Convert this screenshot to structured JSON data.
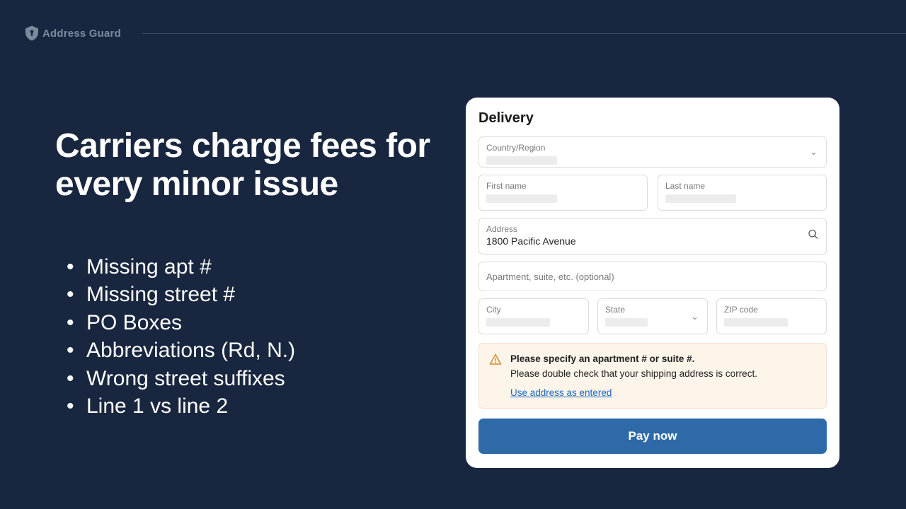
{
  "brand": {
    "name": "Address Guard"
  },
  "headline": "Carriers charge fees for every minor issue",
  "issues": [
    "Missing apt #",
    "Missing street #",
    "PO Boxes",
    "Abbreviations (Rd, N.)",
    "Wrong street suffixes",
    "Line 1 vs line 2"
  ],
  "form": {
    "title": "Delivery",
    "country_label": "Country/Region",
    "first_name_label": "First name",
    "last_name_label": "Last name",
    "address_label": "Address",
    "address_value": "1800 Pacific Avenue",
    "apt_placeholder": "Apartment, suite, etc. (optional)",
    "city_label": "City",
    "state_label": "State",
    "zip_label": "ZIP code"
  },
  "alert": {
    "title": "Please specify an apartment # or suite #.",
    "body": "Please double check that your shipping address is correct.",
    "link": "Use address as entered"
  },
  "cta": {
    "pay": "Pay now"
  }
}
